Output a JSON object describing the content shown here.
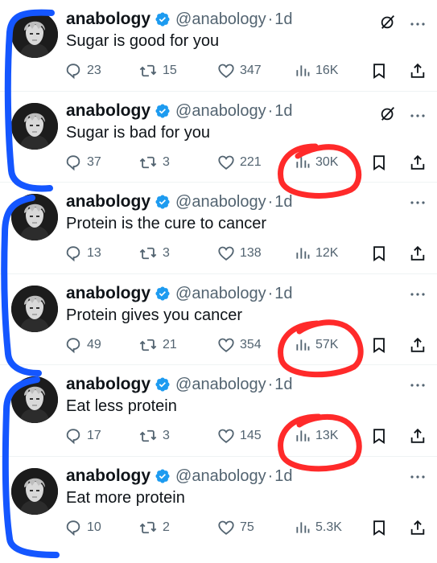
{
  "tweets": [
    {
      "username": "anabology",
      "handle": "@anabology",
      "separator": "·",
      "time": "1d",
      "text": "Sugar is good for you",
      "replies": "23",
      "retweets": "15",
      "likes": "347",
      "views": "16K",
      "grok": true
    },
    {
      "username": "anabology",
      "handle": "@anabology",
      "separator": "·",
      "time": "1d",
      "text": "Sugar is bad for you",
      "replies": "37",
      "retweets": "3",
      "likes": "221",
      "views": "30K",
      "grok": true
    },
    {
      "username": "anabology",
      "handle": "@anabology",
      "separator": "·",
      "time": "1d",
      "text": "Protein is the cure to cancer",
      "replies": "13",
      "retweets": "3",
      "likes": "138",
      "views": "12K",
      "grok": false
    },
    {
      "username": "anabology",
      "handle": "@anabology",
      "separator": "·",
      "time": "1d",
      "text": "Protein gives you cancer",
      "replies": "49",
      "retweets": "21",
      "likes": "354",
      "views": "57K",
      "grok": false
    },
    {
      "username": "anabology",
      "handle": "@anabology",
      "separator": "·",
      "time": "1d",
      "text": "Eat less protein",
      "replies": "17",
      "retweets": "3",
      "likes": "145",
      "views": "13K",
      "grok": false
    },
    {
      "username": "anabology",
      "handle": "@anabology",
      "separator": "·",
      "time": "1d",
      "text": "Eat more protein",
      "replies": "10",
      "retweets": "2",
      "likes": "75",
      "views": "5.3K",
      "grok": false
    }
  ],
  "colors": {
    "verified": "#1d9bf0",
    "annotation_red": "#ff2a2a",
    "annotation_blue": "#1456ff",
    "muted": "#536471"
  }
}
